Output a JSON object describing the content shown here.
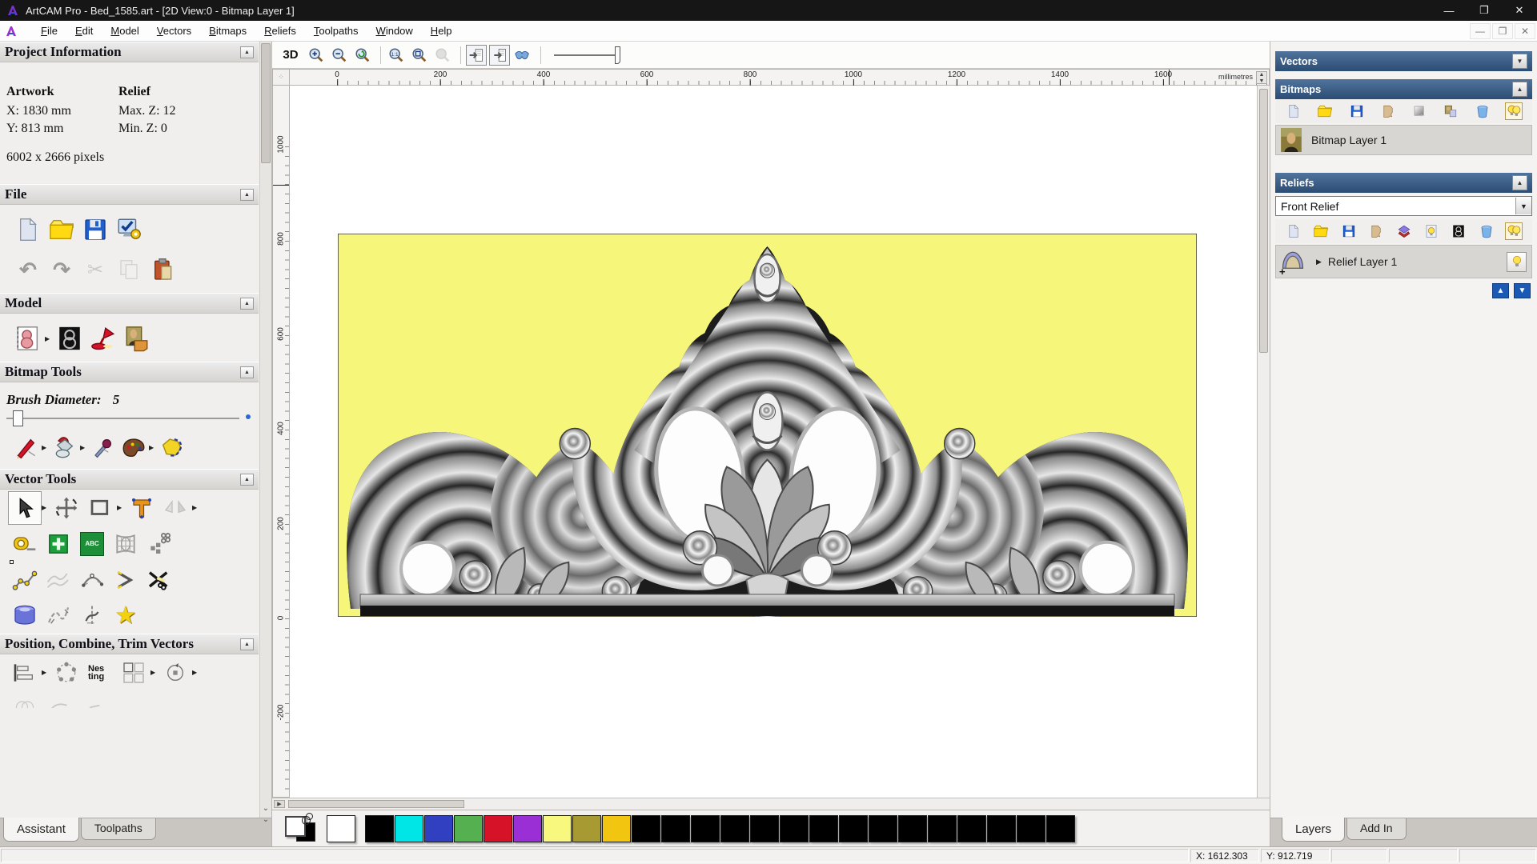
{
  "window": {
    "title": "ArtCAM Pro - Bed_1585.art - [2D View:0 - Bitmap Layer 1]",
    "controls": {
      "minimize": "—",
      "restore": "❐",
      "close": "✕"
    }
  },
  "menu": {
    "items": [
      "File",
      "Edit",
      "Model",
      "Vectors",
      "Bitmaps",
      "Reliefs",
      "Toolpaths",
      "Window",
      "Help"
    ]
  },
  "assistant": {
    "project_info": {
      "title": "Project Information",
      "artwork_label": "Artwork",
      "artwork_x": "X: 1830 mm",
      "artwork_y": "Y: 813 mm",
      "pixels": "6002 x 2666 pixels",
      "relief_label": "Relief",
      "relief_max": "Max. Z: 12",
      "relief_min": "Min. Z: 0"
    },
    "file_section": {
      "title": "File"
    },
    "model_section": {
      "title": "Model"
    },
    "bitmap_tools": {
      "title": "Bitmap Tools",
      "brush_label": "Brush Diameter:",
      "brush_value": "5"
    },
    "vector_tools": {
      "title": "Vector Tools"
    },
    "position_section": {
      "title": "Position, Combine, Trim Vectors"
    },
    "tabs": [
      {
        "label": "Assistant"
      },
      {
        "label": "Toolpaths"
      }
    ]
  },
  "canvas": {
    "toolbar": {
      "view3d_label": "3D"
    },
    "ruler": {
      "unit": "millimetres",
      "top_ticks": [
        "0",
        "200",
        "400",
        "600",
        "800",
        "1000",
        "1200",
        "1400",
        "1600"
      ],
      "left_ticks": [
        "1000",
        "800",
        "600",
        "400",
        "200",
        "0",
        "-200"
      ]
    }
  },
  "right_panel": {
    "vectors": {
      "title": "Vectors"
    },
    "bitmaps": {
      "title": "Bitmaps",
      "layer_name": "Bitmap Layer 1"
    },
    "reliefs": {
      "title": "Reliefs",
      "selected_relief": "Front Relief",
      "layer_name": "Relief Layer 1"
    },
    "tabs": [
      {
        "label": "Layers"
      },
      {
        "label": "Add In"
      }
    ]
  },
  "palette": {
    "primary": "#ffffff",
    "secondary": "#000000",
    "colors": [
      "#ffffff",
      "#000000",
      "#00e6e6",
      "#3040c0",
      "#55b050",
      "#d51228",
      "#9b2fd6",
      "#f8f87e",
      "#a89a33",
      "#f2c511",
      "#000000",
      "#000000",
      "#000000",
      "#000000",
      "#000000",
      "#000000",
      "#000000",
      "#000000",
      "#000000",
      "#000000",
      "#000000",
      "#000000",
      "#000000",
      "#000000",
      "#000000"
    ]
  },
  "status_bar": {
    "x": "X: 1612.303",
    "y": "Y: 912.719"
  },
  "icon_texts": {
    "abc": "ABC",
    "nesting": "Nes ting"
  }
}
